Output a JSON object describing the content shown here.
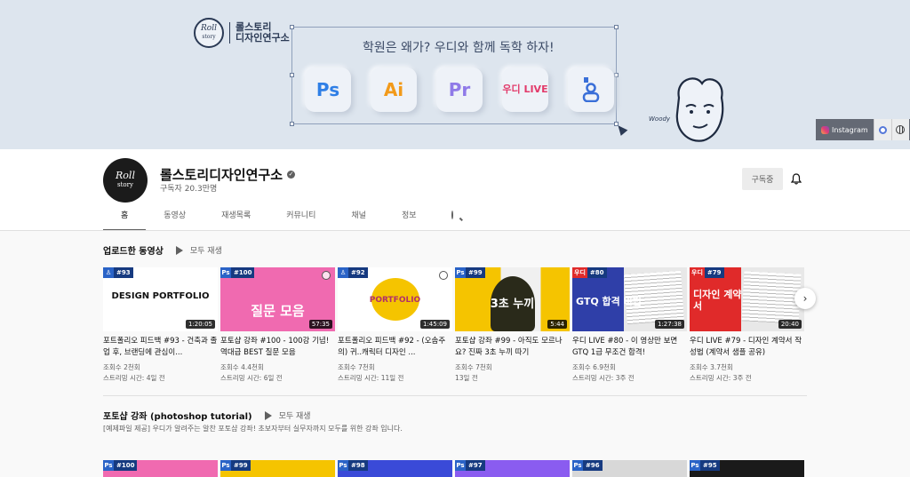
{
  "banner": {
    "brand_name_line1": "롤스토리",
    "brand_name_line2": "디자인연구소",
    "logo_line1": "Roll",
    "logo_line2": "story",
    "headline": "학원은 왜가? 우디와 함께 독학 하자!",
    "tiles": [
      "Ps",
      "Ai",
      "Pr",
      "우디 LIVE"
    ],
    "woody_label": "Woody",
    "instagram_label": "Instagram",
    "icons": [
      "instagram-icon",
      "circle-link-icon",
      "globe-icon"
    ]
  },
  "channel": {
    "avatar_line1": "Roll",
    "avatar_line2": "story",
    "name": "롤스토리디자인연구소",
    "subscribers": "구독자 20.3만명",
    "subscribe_label": "구독중"
  },
  "tabs": [
    "홈",
    "동영상",
    "재생목록",
    "커뮤니티",
    "채널",
    "정보"
  ],
  "shelf1": {
    "title": "업로드한 동영상",
    "play_all": "모두 재생",
    "videos": [
      {
        "badge_app": "",
        "badge_num": "#93",
        "thumb_text": "DESIGN PORTFOLIO",
        "duration": "1:20:05",
        "title": "포트폴리오 피드백 #93 - 건축과 졸업 후, 브랜딩에 관심이...",
        "views": "조회수 2천회",
        "time": "스트리밍 시간: 4일 전",
        "bg": "#ffffff",
        "fg": "#111111"
      },
      {
        "badge_app": "Ps",
        "badge_num": "#100",
        "thumb_text": "질문 모음",
        "duration": "57:35",
        "title": "포토샵 강좌 #100 - 100강 기념! 역대급 BEST 질문 모음",
        "views": "조회수 4.4천회",
        "time": "스트리밍 시간: 6일 전",
        "bg": "#f06ab0",
        "fg": "#ffffff"
      },
      {
        "badge_app": "",
        "badge_num": "#92",
        "thumb_text": "PORTFOLIO",
        "duration": "1:45:09",
        "title": "포트폴리오 피드백 #92 - (오솜주의) 귀..캐릭터 디자인 ...",
        "views": "조회수 7천회",
        "time": "스트리밍 시간: 11일 전",
        "bg": "#ffffff",
        "fg": "#b0306a"
      },
      {
        "badge_app": "Ps",
        "badge_num": "#99",
        "thumb_text": "3초 누끼",
        "duration": "5:44",
        "title": "포토샵 강좌 #99 - 아직도 모르나요? 진짜 3초 누끼 따기",
        "views": "조회수 7천회",
        "time": "13일 전",
        "bg": "#f5c400",
        "fg": "#ffffff"
      },
      {
        "badge_app": "우디",
        "badge_num": "#80",
        "thumb_text": "GTQ 합격 비법",
        "duration": "1:27:38",
        "title": "우디 LIVE #80 - 이 영상만 보면 GTQ 1급 무조건 합격!",
        "views": "조회수 6.9천회",
        "time": "스트리밍 시간: 3주 전",
        "bg": "#2f3fa8",
        "fg": "#ffffff"
      },
      {
        "badge_app": "우디",
        "badge_num": "#79",
        "thumb_text": "디자인 계약서",
        "duration": "20:40",
        "title": "우디 LIVE #79 - 디자인 계약서 작성법 (계약서 샘플 공유)",
        "views": "조회수 3.7천회",
        "time": "스트리밍 시간: 3주 전",
        "bg": "#e02a2a",
        "fg": "#ffffff"
      }
    ]
  },
  "shelf2": {
    "title": "포토샵 강좌 (photoshop tutorial)",
    "play_all": "모두 재생",
    "description": "[예제파일 제공] 우디가 알려주는 알찬 포토샵 강좌! 초보자부터 실무자까지 모두를 위한 강좌 입니다.",
    "videos": [
      {
        "badge_app": "Ps",
        "badge_num": "#100",
        "bg": "#f06ab0"
      },
      {
        "badge_app": "Ps",
        "badge_num": "#99",
        "bg": "#f5c400"
      },
      {
        "badge_app": "Ps",
        "badge_num": "#98",
        "bg": "#3a4ad8"
      },
      {
        "badge_app": "Ps",
        "badge_num": "#97",
        "bg": "#8a5cf0"
      },
      {
        "badge_app": "Ps",
        "badge_num": "#96",
        "bg": "#d8d8d8"
      },
      {
        "badge_app": "Ps",
        "badge_num": "#95",
        "bg": "#1a1a1a"
      }
    ]
  },
  "colors": {
    "banner_bg": "#dde5ee",
    "badge_blue": "#2a63c7",
    "badge_red": "#e02a2a"
  }
}
